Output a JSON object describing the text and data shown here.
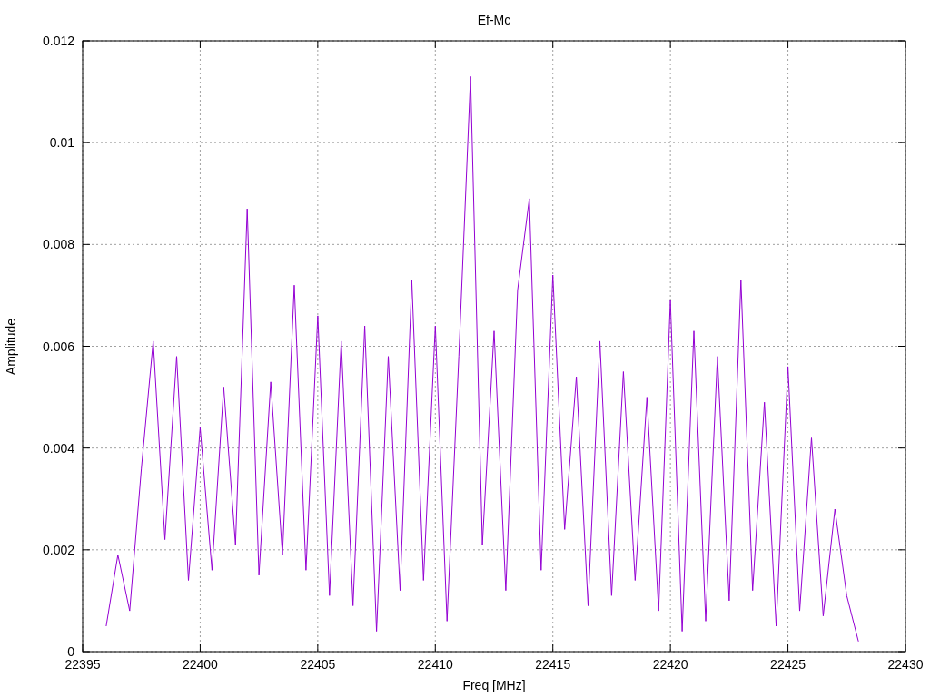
{
  "chart_data": {
    "type": "line",
    "title": "Ef-Mc",
    "xlabel": "Freq [MHz]",
    "ylabel": "Amplitude",
    "grid": true,
    "xlim": [
      22395,
      22430
    ],
    "ylim": [
      0,
      0.012
    ],
    "xticks": [
      22395,
      22400,
      22405,
      22410,
      22415,
      22420,
      22425,
      22430
    ],
    "yticks": [
      0.012,
      0.01,
      0.008,
      0.006,
      0.004,
      0.002,
      0
    ],
    "x": [
      22396,
      22396.5,
      22397,
      22397.5,
      22398,
      22398.5,
      22399,
      22399.5,
      22400,
      22400.5,
      22401,
      22401.5,
      22402,
      22402.5,
      22403,
      22403.5,
      22404,
      22404.5,
      22405,
      22405.5,
      22406,
      22406.5,
      22407,
      22407.5,
      22408,
      22408.5,
      22409,
      22409.5,
      22410,
      22410.5,
      22411,
      22411.5,
      22412,
      22412.5,
      22413,
      22413.5,
      22414,
      22414.5,
      22415,
      22415.5,
      22416,
      22416.5,
      22417,
      22417.5,
      22418,
      22418.5,
      22419,
      22419.5,
      22420,
      22420.5,
      22421,
      22421.5,
      22422,
      22422.5,
      22423,
      22423.5,
      22424,
      22424.5,
      22425,
      22425.5,
      22426,
      22426.5,
      22427,
      22427.5,
      22428
    ],
    "series": [
      {
        "color": "#9400d3",
        "values": [
          0.0005,
          0.0019,
          0.0008,
          0.0036,
          0.0061,
          0.0022,
          0.0058,
          0.0014,
          0.0044,
          0.0016,
          0.0052,
          0.0021,
          0.0087,
          0.0015,
          0.0053,
          0.0019,
          0.0072,
          0.0016,
          0.0066,
          0.0011,
          0.0061,
          0.0009,
          0.0064,
          0.0004,
          0.0058,
          0.0012,
          0.0073,
          0.0014,
          0.0064,
          0.0006,
          0.0058,
          0.0113,
          0.0021,
          0.0063,
          0.0012,
          0.0071,
          0.0089,
          0.0016,
          0.0074,
          0.0024,
          0.0054,
          0.0009,
          0.0061,
          0.0011,
          0.0055,
          0.0014,
          0.005,
          0.0008,
          0.0069,
          0.0004,
          0.0063,
          0.0006,
          0.0058,
          0.001,
          0.0073,
          0.0012,
          0.0049,
          0.0005,
          0.0056,
          0.0008,
          0.0042,
          0.0007,
          0.0028,
          0.0011,
          0.0002
        ]
      }
    ]
  }
}
